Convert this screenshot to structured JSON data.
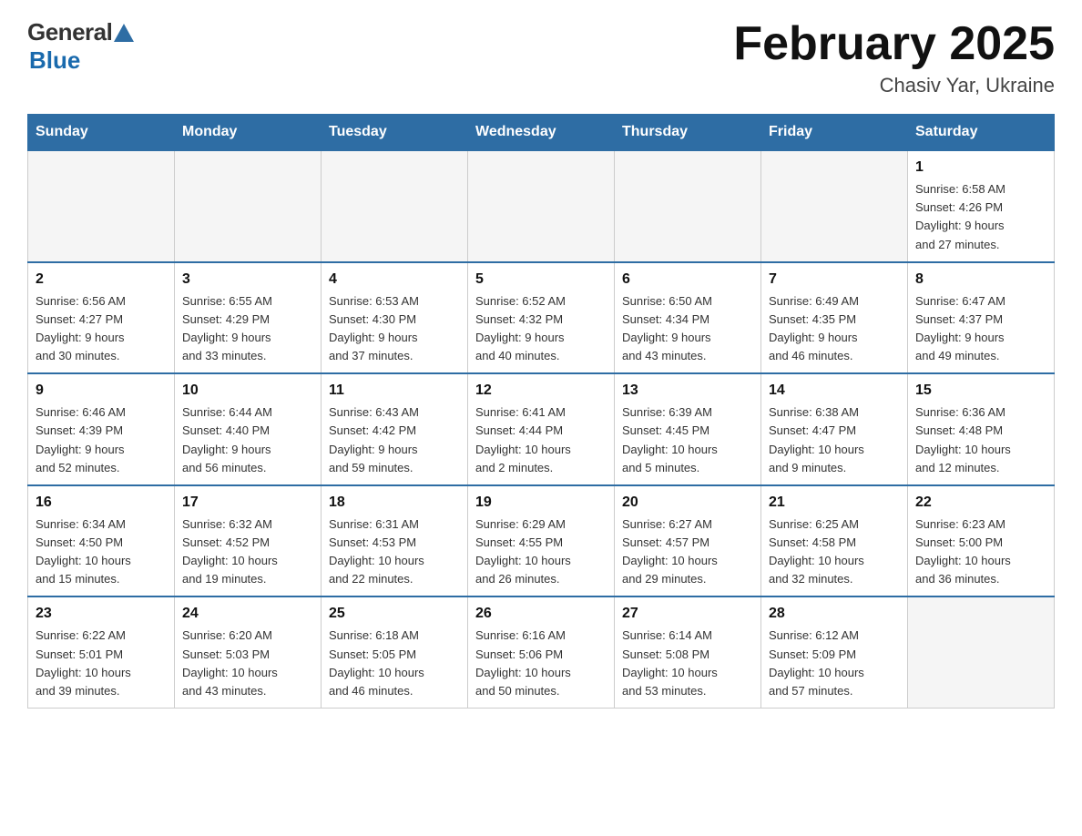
{
  "header": {
    "logo_general": "General",
    "logo_blue": "Blue",
    "month_year": "February 2025",
    "location": "Chasiv Yar, Ukraine"
  },
  "days_of_week": [
    "Sunday",
    "Monday",
    "Tuesday",
    "Wednesday",
    "Thursday",
    "Friday",
    "Saturday"
  ],
  "weeks": [
    [
      {
        "day": "",
        "info": ""
      },
      {
        "day": "",
        "info": ""
      },
      {
        "day": "",
        "info": ""
      },
      {
        "day": "",
        "info": ""
      },
      {
        "day": "",
        "info": ""
      },
      {
        "day": "",
        "info": ""
      },
      {
        "day": "1",
        "info": "Sunrise: 6:58 AM\nSunset: 4:26 PM\nDaylight: 9 hours\nand 27 minutes."
      }
    ],
    [
      {
        "day": "2",
        "info": "Sunrise: 6:56 AM\nSunset: 4:27 PM\nDaylight: 9 hours\nand 30 minutes."
      },
      {
        "day": "3",
        "info": "Sunrise: 6:55 AM\nSunset: 4:29 PM\nDaylight: 9 hours\nand 33 minutes."
      },
      {
        "day": "4",
        "info": "Sunrise: 6:53 AM\nSunset: 4:30 PM\nDaylight: 9 hours\nand 37 minutes."
      },
      {
        "day": "5",
        "info": "Sunrise: 6:52 AM\nSunset: 4:32 PM\nDaylight: 9 hours\nand 40 minutes."
      },
      {
        "day": "6",
        "info": "Sunrise: 6:50 AM\nSunset: 4:34 PM\nDaylight: 9 hours\nand 43 minutes."
      },
      {
        "day": "7",
        "info": "Sunrise: 6:49 AM\nSunset: 4:35 PM\nDaylight: 9 hours\nand 46 minutes."
      },
      {
        "day": "8",
        "info": "Sunrise: 6:47 AM\nSunset: 4:37 PM\nDaylight: 9 hours\nand 49 minutes."
      }
    ],
    [
      {
        "day": "9",
        "info": "Sunrise: 6:46 AM\nSunset: 4:39 PM\nDaylight: 9 hours\nand 52 minutes."
      },
      {
        "day": "10",
        "info": "Sunrise: 6:44 AM\nSunset: 4:40 PM\nDaylight: 9 hours\nand 56 minutes."
      },
      {
        "day": "11",
        "info": "Sunrise: 6:43 AM\nSunset: 4:42 PM\nDaylight: 9 hours\nand 59 minutes."
      },
      {
        "day": "12",
        "info": "Sunrise: 6:41 AM\nSunset: 4:44 PM\nDaylight: 10 hours\nand 2 minutes."
      },
      {
        "day": "13",
        "info": "Sunrise: 6:39 AM\nSunset: 4:45 PM\nDaylight: 10 hours\nand 5 minutes."
      },
      {
        "day": "14",
        "info": "Sunrise: 6:38 AM\nSunset: 4:47 PM\nDaylight: 10 hours\nand 9 minutes."
      },
      {
        "day": "15",
        "info": "Sunrise: 6:36 AM\nSunset: 4:48 PM\nDaylight: 10 hours\nand 12 minutes."
      }
    ],
    [
      {
        "day": "16",
        "info": "Sunrise: 6:34 AM\nSunset: 4:50 PM\nDaylight: 10 hours\nand 15 minutes."
      },
      {
        "day": "17",
        "info": "Sunrise: 6:32 AM\nSunset: 4:52 PM\nDaylight: 10 hours\nand 19 minutes."
      },
      {
        "day": "18",
        "info": "Sunrise: 6:31 AM\nSunset: 4:53 PM\nDaylight: 10 hours\nand 22 minutes."
      },
      {
        "day": "19",
        "info": "Sunrise: 6:29 AM\nSunset: 4:55 PM\nDaylight: 10 hours\nand 26 minutes."
      },
      {
        "day": "20",
        "info": "Sunrise: 6:27 AM\nSunset: 4:57 PM\nDaylight: 10 hours\nand 29 minutes."
      },
      {
        "day": "21",
        "info": "Sunrise: 6:25 AM\nSunset: 4:58 PM\nDaylight: 10 hours\nand 32 minutes."
      },
      {
        "day": "22",
        "info": "Sunrise: 6:23 AM\nSunset: 5:00 PM\nDaylight: 10 hours\nand 36 minutes."
      }
    ],
    [
      {
        "day": "23",
        "info": "Sunrise: 6:22 AM\nSunset: 5:01 PM\nDaylight: 10 hours\nand 39 minutes."
      },
      {
        "day": "24",
        "info": "Sunrise: 6:20 AM\nSunset: 5:03 PM\nDaylight: 10 hours\nand 43 minutes."
      },
      {
        "day": "25",
        "info": "Sunrise: 6:18 AM\nSunset: 5:05 PM\nDaylight: 10 hours\nand 46 minutes."
      },
      {
        "day": "26",
        "info": "Sunrise: 6:16 AM\nSunset: 5:06 PM\nDaylight: 10 hours\nand 50 minutes."
      },
      {
        "day": "27",
        "info": "Sunrise: 6:14 AM\nSunset: 5:08 PM\nDaylight: 10 hours\nand 53 minutes."
      },
      {
        "day": "28",
        "info": "Sunrise: 6:12 AM\nSunset: 5:09 PM\nDaylight: 10 hours\nand 57 minutes."
      },
      {
        "day": "",
        "info": ""
      }
    ]
  ]
}
